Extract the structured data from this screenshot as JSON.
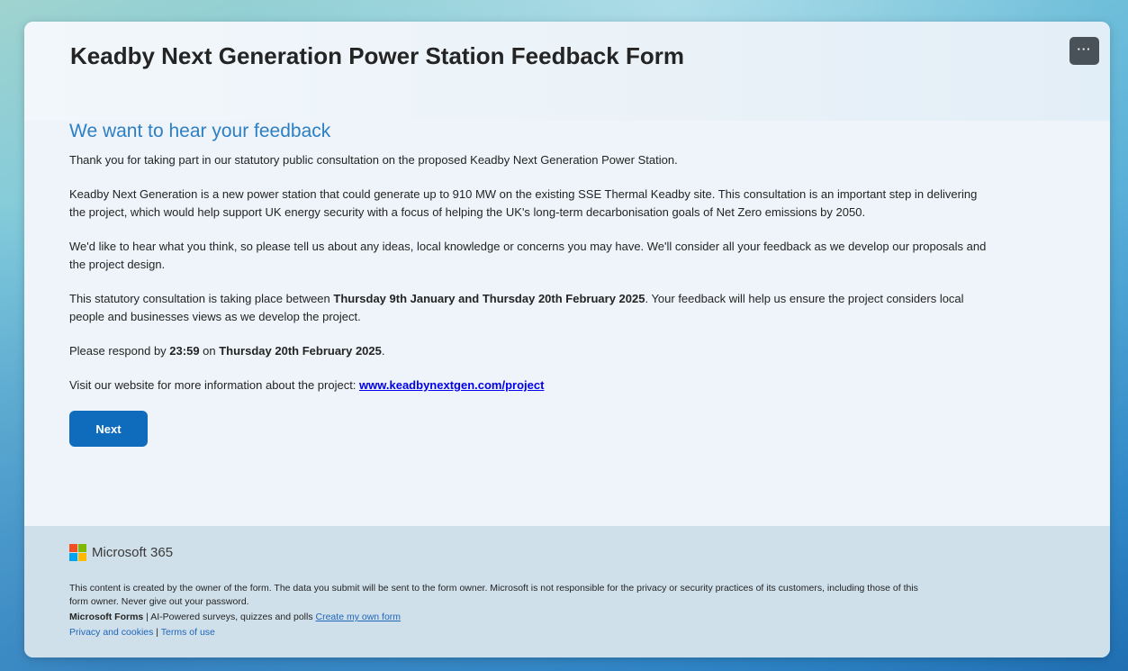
{
  "form": {
    "title": "Keadby Next Generation Power Station Feedback Form",
    "more_label": "···"
  },
  "intro": {
    "heading": "We want to hear your feedback",
    "para1": "Thank you for taking part in our statutory public consultation on the proposed Keadby Next Generation Power Station.",
    "para2_line1": "Keadby Next Generation is a new power station that could generate up to 910 MW on the existing SSE Thermal Keadby site. This consultation is an important step in delivering",
    "para2_line2": "the project, which would help support UK energy security with a focus of helping the UK's long-term decarbonisation goals of Net Zero emissions by 2050.",
    "para3_line1": "We'd like to hear what you think, so please tell us about any ideas, local knowledge or concerns you may have. We'll consider all your feedback as we develop our proposals and",
    "para3_line2": "the project design.",
    "para4_prefix": "This statutory consultation is taking place between ",
    "para4_dates": "Thursday 9th January and Thursday 20th February 2025",
    "para4_suffix_line1": ".  Your feedback will help us ensure the project considers local",
    "para4_line2": "people and businesses views as we develop the project.",
    "para5_prefix": "Please respond by ",
    "para5_time": "23:59",
    "para5_mid": " on ",
    "para5_date": "Thursday 20th February 2025",
    "para5_suffix": ".",
    "para6_prefix": "Visit our website for more information about the project: ",
    "para6_link": "www.keadbynextgen.com/project",
    "next_label": "Next"
  },
  "footer": {
    "brand": "Microsoft 365",
    "logo_colors": [
      "#f25022",
      "#7fba00",
      "#00a4ef",
      "#ffb900"
    ],
    "disclaimer_line1": "This content is created by the owner of the form. The data you submit will be sent to the form owner. Microsoft is not responsible for the privacy or security practices of its customers, including those of this",
    "disclaimer_line2": "form owner. Never give out your password.",
    "forms_name": "Microsoft Forms",
    "forms_tagline": " | AI-Powered surveys, quizzes and polls ",
    "create_link": "Create my own form",
    "privacy_link": "Privacy and cookies",
    "separator": " | ",
    "terms_link": "Terms of use"
  }
}
